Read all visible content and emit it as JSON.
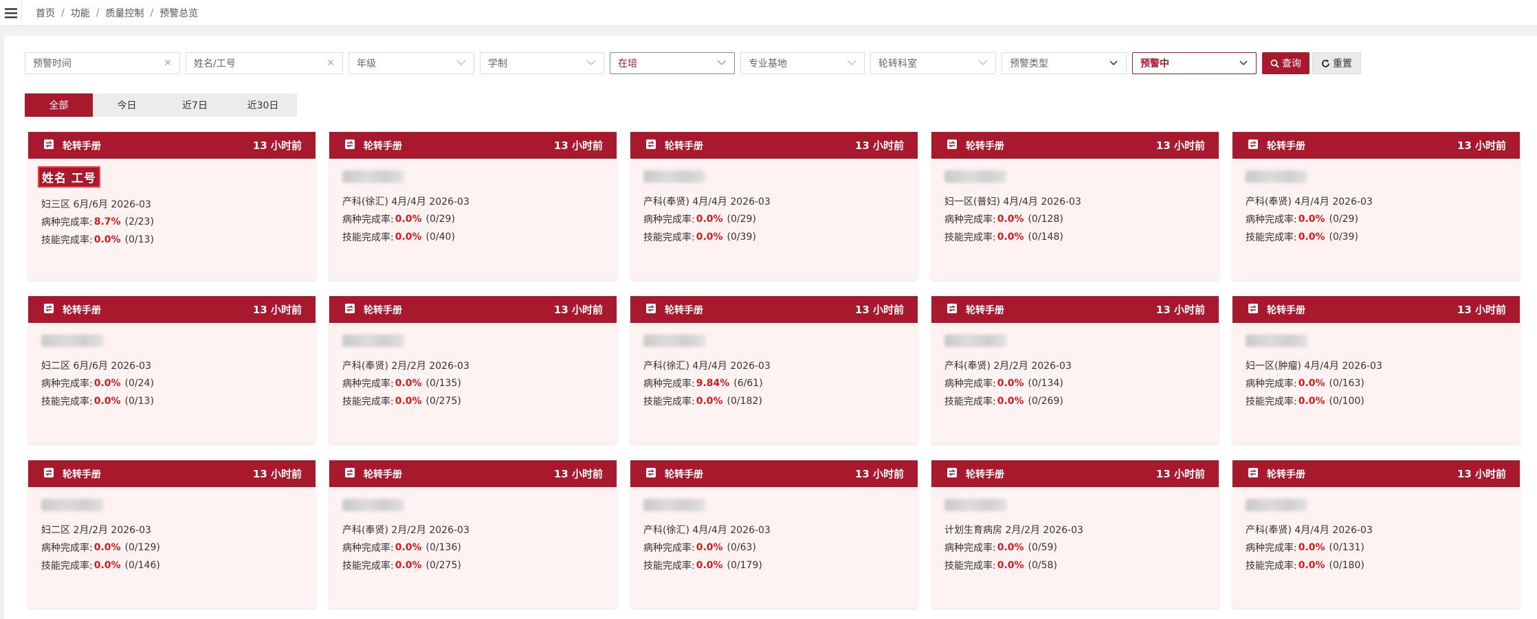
{
  "breadcrumb": [
    "首页",
    "功能",
    "质量控制",
    "预警总览"
  ],
  "filters": {
    "warn_time": "预警时间",
    "name_id": "姓名/工号",
    "grade": "年级",
    "school_system": "学制",
    "status": "在培",
    "base": "专业基地",
    "dept": "轮转科室",
    "warn_type": "预警类型",
    "warn_state": "预警中",
    "query": "查询",
    "reset": "重置"
  },
  "tabs": [
    "全部",
    "今日",
    "近7日",
    "近30日"
  ],
  "labels": {
    "disease": "病种完成率:",
    "skill": "技能完成率:"
  },
  "highlight_name": "姓名 工号",
  "cards": [
    {
      "title": "轮转手册",
      "time": "13 小时前",
      "info": "妇三区 6月/6月 2026-03",
      "d_pct": "8.7%",
      "d_cnt": "(2/23)",
      "s_pct": "0.0%",
      "s_cnt": "(0/13)"
    },
    {
      "title": "轮转手册",
      "time": "13 小时前",
      "info": "产科(徐汇) 4月/4月 2026-03",
      "d_pct": "0.0%",
      "d_cnt": "(0/29)",
      "s_pct": "0.0%",
      "s_cnt": "(0/40)"
    },
    {
      "title": "轮转手册",
      "time": "13 小时前",
      "info": "产科(奉贤) 4月/4月 2026-03",
      "d_pct": "0.0%",
      "d_cnt": "(0/29)",
      "s_pct": "0.0%",
      "s_cnt": "(0/39)"
    },
    {
      "title": "轮转手册",
      "time": "13 小时前",
      "info": "妇一区(普妇) 4月/4月 2026-03",
      "d_pct": "0.0%",
      "d_cnt": "(0/128)",
      "s_pct": "0.0%",
      "s_cnt": "(0/148)"
    },
    {
      "title": "轮转手册",
      "time": "13 小时前",
      "info": "产科(奉贤) 4月/4月 2026-03",
      "d_pct": "0.0%",
      "d_cnt": "(0/29)",
      "s_pct": "0.0%",
      "s_cnt": "(0/39)"
    },
    {
      "title": "轮转手册",
      "time": "13 小时前",
      "info": "妇二区 6月/6月 2026-03",
      "d_pct": "0.0%",
      "d_cnt": "(0/24)",
      "s_pct": "0.0%",
      "s_cnt": "(0/13)"
    },
    {
      "title": "轮转手册",
      "time": "13 小时前",
      "info": "产科(奉贤) 2月/2月 2026-03",
      "d_pct": "0.0%",
      "d_cnt": "(0/135)",
      "s_pct": "0.0%",
      "s_cnt": "(0/275)"
    },
    {
      "title": "轮转手册",
      "time": "13 小时前",
      "info": "产科(徐汇) 4月/4月 2026-03",
      "d_pct": "9.84%",
      "d_cnt": "(6/61)",
      "s_pct": "0.0%",
      "s_cnt": "(0/182)"
    },
    {
      "title": "轮转手册",
      "time": "13 小时前",
      "info": "产科(奉贤) 2月/2月 2026-03",
      "d_pct": "0.0%",
      "d_cnt": "(0/134)",
      "s_pct": "0.0%",
      "s_cnt": "(0/269)"
    },
    {
      "title": "轮转手册",
      "time": "13 小时前",
      "info": "妇一区(肿瘤) 4月/4月 2026-03",
      "d_pct": "0.0%",
      "d_cnt": "(0/163)",
      "s_pct": "0.0%",
      "s_cnt": "(0/100)"
    },
    {
      "title": "轮转手册",
      "time": "13 小时前",
      "info": "妇二区 2月/2月 2026-03",
      "d_pct": "0.0%",
      "d_cnt": "(0/129)",
      "s_pct": "0.0%",
      "s_cnt": "(0/146)"
    },
    {
      "title": "轮转手册",
      "time": "13 小时前",
      "info": "产科(奉贤) 2月/2月 2026-03",
      "d_pct": "0.0%",
      "d_cnt": "(0/136)",
      "s_pct": "0.0%",
      "s_cnt": "(0/275)"
    },
    {
      "title": "轮转手册",
      "time": "13 小时前",
      "info": "产科(徐汇) 4月/4月 2026-03",
      "d_pct": "0.0%",
      "d_cnt": "(0/63)",
      "s_pct": "0.0%",
      "s_cnt": "(0/179)"
    },
    {
      "title": "轮转手册",
      "time": "13 小时前",
      "info": "计划生育病房 2月/2月 2026-03",
      "d_pct": "0.0%",
      "d_cnt": "(0/59)",
      "s_pct": "0.0%",
      "s_cnt": "(0/58)"
    },
    {
      "title": "轮转手册",
      "time": "13 小时前",
      "info": "产科(奉贤) 4月/4月 2026-03",
      "d_pct": "0.0%",
      "d_cnt": "(0/131)",
      "s_pct": "0.0%",
      "s_cnt": "(0/180)"
    }
  ]
}
